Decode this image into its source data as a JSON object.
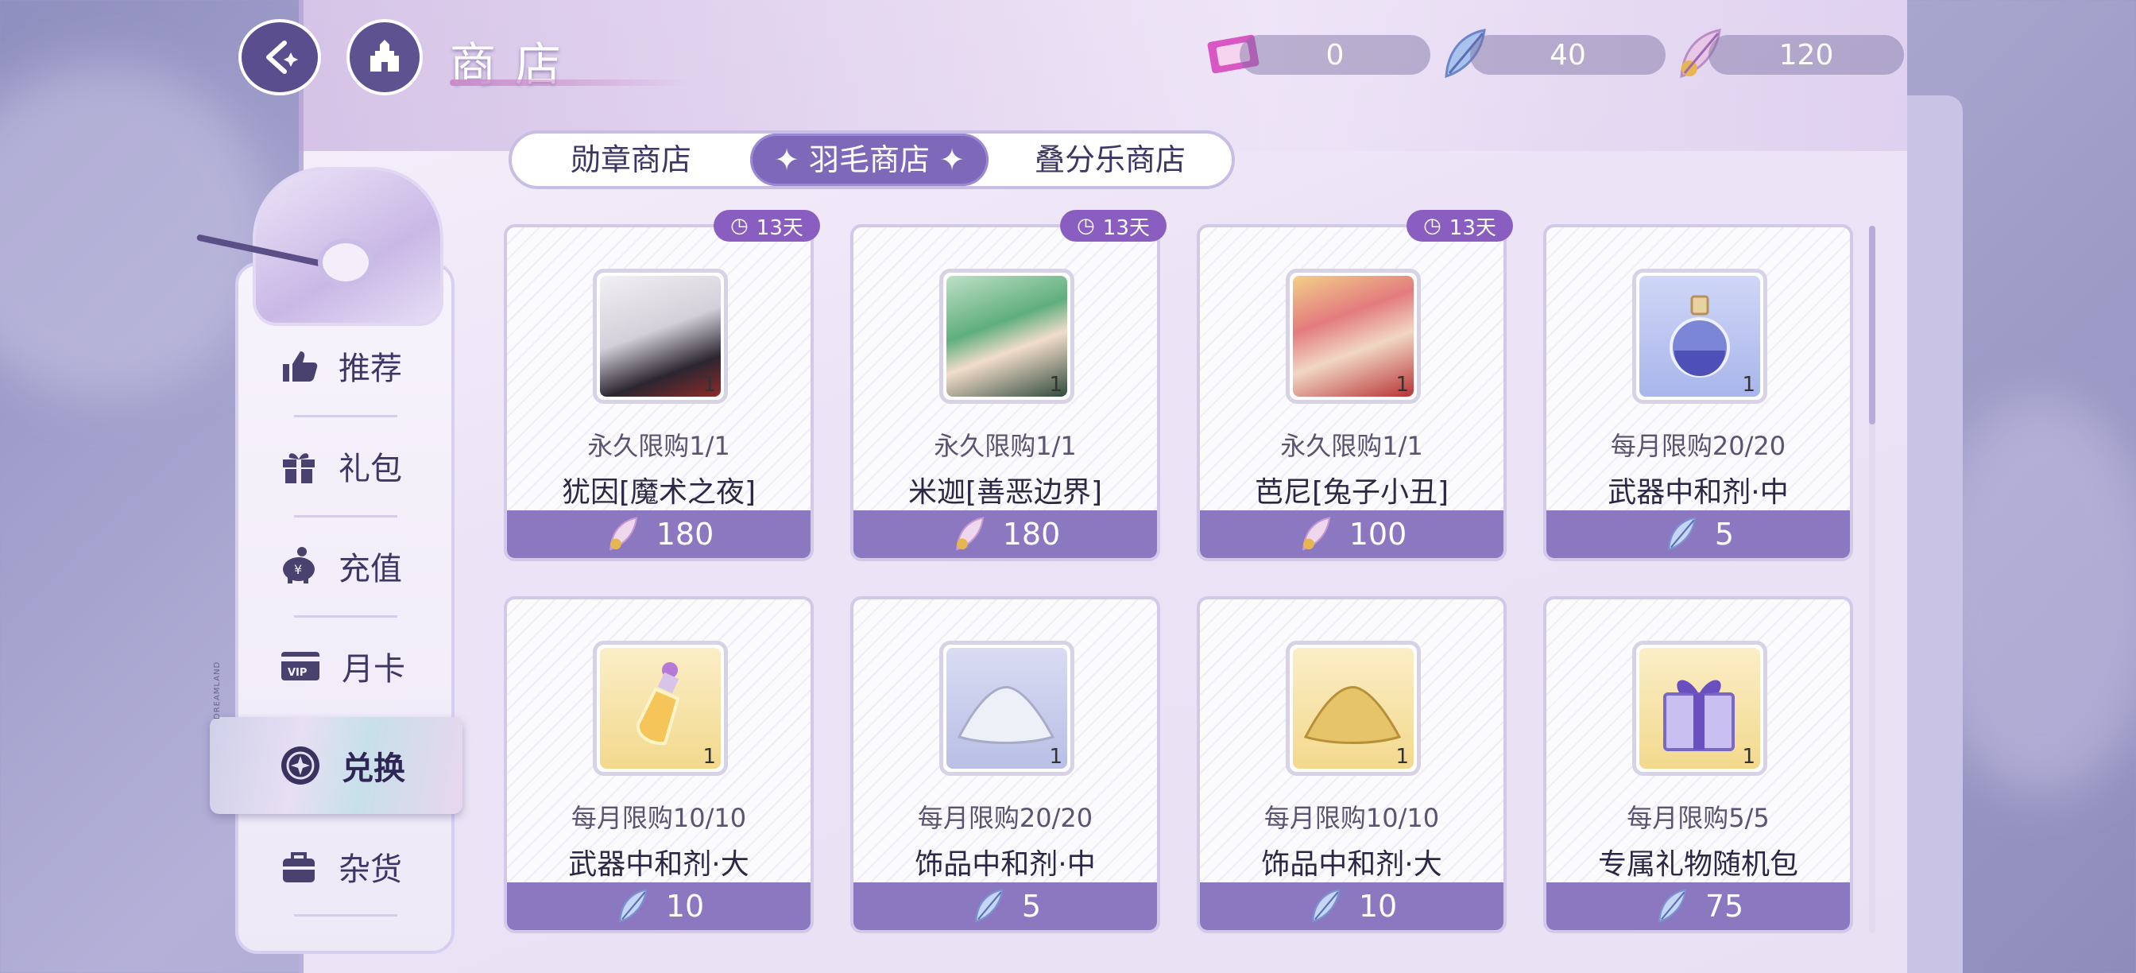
{
  "header": {
    "title": "商店",
    "back_icon": "back-arrow-icon",
    "home_icon": "castle-icon",
    "currencies": [
      {
        "icon": "ticket-icon",
        "value": "0"
      },
      {
        "icon": "blue-feather-icon",
        "value": "40"
      },
      {
        "icon": "gold-feather-icon",
        "value": "120"
      }
    ]
  },
  "tabs": [
    {
      "label": "勋章商店",
      "active": false
    },
    {
      "label": "羽毛商店",
      "active": true
    },
    {
      "label": "叠分乐商店",
      "active": false
    }
  ],
  "nav": {
    "side_text": "DREAMLAND",
    "items": [
      {
        "label": "推荐",
        "icon": "thumbs-up-icon",
        "active": false
      },
      {
        "label": "礼包",
        "icon": "gift-icon",
        "active": false
      },
      {
        "label": "充值",
        "icon": "piggy-bank-icon",
        "active": false
      },
      {
        "label": "月卡",
        "icon": "vip-card-icon",
        "active": false
      },
      {
        "label": "兑换",
        "icon": "exchange-icon",
        "active": true
      },
      {
        "label": "杂货",
        "icon": "bag-icon",
        "active": false
      }
    ]
  },
  "items": [
    {
      "name": "犹因[魔术之夜]",
      "limit": "永久限购1/1",
      "qty": "1",
      "price": "180",
      "currency": "gold-feather-icon",
      "badge": "13天",
      "icon": "character-portrait-silver-hair"
    },
    {
      "name": "米迦[善恶边界]",
      "limit": "永久限购1/1",
      "qty": "1",
      "price": "180",
      "currency": "gold-feather-icon",
      "badge": "13天",
      "icon": "character-portrait-green-hair"
    },
    {
      "name": "芭尼[兔子小丑]",
      "limit": "永久限购1/1",
      "qty": "1",
      "price": "100",
      "currency": "gold-feather-icon",
      "badge": "13天",
      "icon": "character-portrait-pink-hair"
    },
    {
      "name": "武器中和剂·中",
      "limit": "每月限购20/20",
      "qty": "1",
      "price": "5",
      "currency": "blue-feather-icon",
      "badge": "",
      "icon": "blue-potion-icon"
    },
    {
      "name": "武器中和剂·大",
      "limit": "每月限购10/10",
      "qty": "1",
      "price": "10",
      "currency": "blue-feather-icon",
      "badge": "",
      "icon": "gold-potion-icon"
    },
    {
      "name": "饰品中和剂·中",
      "limit": "每月限购20/20",
      "qty": "1",
      "price": "5",
      "currency": "blue-feather-icon",
      "badge": "",
      "icon": "silver-powder-icon"
    },
    {
      "name": "饰品中和剂·大",
      "limit": "每月限购10/10",
      "qty": "1",
      "price": "10",
      "currency": "blue-feather-icon",
      "badge": "",
      "icon": "gold-powder-icon"
    },
    {
      "name": "专属礼物随机包",
      "limit": "每月限购5/5",
      "qty": "1",
      "price": "75",
      "currency": "blue-feather-icon",
      "badge": "",
      "icon": "gift-box-icon"
    }
  ],
  "colors": {
    "accent": "#7d68b9",
    "price_bar": "#8b78c0",
    "badge": "#8a5ec0"
  }
}
